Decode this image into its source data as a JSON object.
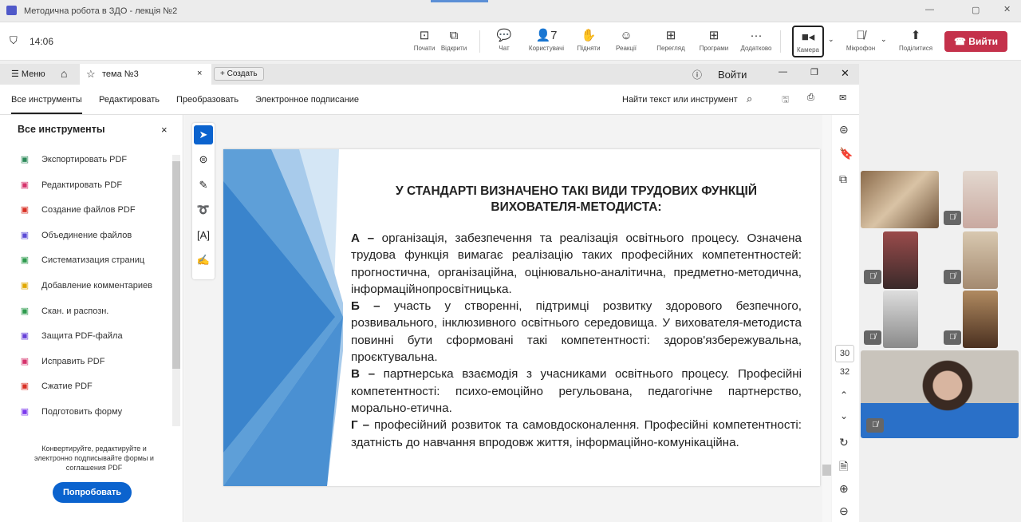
{
  "window": {
    "title": "Методична робота в ЗДО - лекція №2"
  },
  "meeting": {
    "time": "14:06",
    "participants_count": "7",
    "buttons": [
      {
        "label": "Почати",
        "icon": "present-icon"
      },
      {
        "label": "Відкрити",
        "icon": "popout-icon"
      },
      {
        "label": "Чат",
        "icon": "chat-icon"
      },
      {
        "label": "Користувачі",
        "icon": "people-icon"
      },
      {
        "label": "Підняти",
        "icon": "hand-icon"
      },
      {
        "label": "Реакції",
        "icon": "smile-icon"
      },
      {
        "label": "Перегляд",
        "icon": "layout-icon"
      },
      {
        "label": "Програми",
        "icon": "apps-icon"
      },
      {
        "label": "Додатково",
        "icon": "more-icon"
      }
    ],
    "camera": "Камера",
    "mic": "Мікрофон",
    "share": "Поділитися",
    "leave": "Вийти"
  },
  "acrobat": {
    "menu": "Меню",
    "tab": "тема №3",
    "create": "Создать",
    "signin": "Войти",
    "toolbar_tabs": [
      "Все инструменты",
      "Редактировать",
      "Преобразовать",
      "Электронное подписание"
    ],
    "search": "Найти текст или инструмент",
    "panel_title": "Все инструменты",
    "tools": [
      {
        "label": "Экспортировать PDF",
        "color": "#2d8a5a"
      },
      {
        "label": "Редактировать PDF",
        "color": "#d6336c"
      },
      {
        "label": "Создание файлов PDF",
        "color": "#d93025"
      },
      {
        "label": "Объединение файлов",
        "color": "#5b4bd6"
      },
      {
        "label": "Систематизация страниц",
        "color": "#2e9b4e"
      },
      {
        "label": "Добавление комментариев",
        "color": "#e0a800"
      },
      {
        "label": "Скан. и распозн.",
        "color": "#2e9b4e"
      },
      {
        "label": "Защита PDF-файла",
        "color": "#6741d9"
      },
      {
        "label": "Исправить PDF",
        "color": "#d6336c"
      },
      {
        "label": "Сжатие PDF",
        "color": "#d93025"
      },
      {
        "label": "Подготовить форму",
        "color": "#7c3aed"
      }
    ],
    "promo": "Конвертируйте, редактируйте и электронно подписывайте формы и соглашения PDF",
    "try": "Попробовать",
    "page_current": "30",
    "page_total": "32"
  },
  "slide": {
    "title": "У СТАНДАРТІ ВИЗНАЧЕНО ТАКІ ВИДИ ТРУДОВИХ ФУНКЦІЙ ВИХОВАТЕЛЯ-МЕТОДИСТА:",
    "paragraphs": [
      {
        "key": "А –",
        "text": " організація, забезпечення та реалізація освітнього процесу. Означена трудова функція вимагає реалізацію таких професійних компетентностей: прогностична, організаційна, оцінювально-аналітична, предметно-методична, інформаційнопросвітницька."
      },
      {
        "key": "Б –",
        "text": " участь у створенні, підтримці розвитку здорового безпечного, розвивального, інклюзивного освітнього середовища. У вихователя-методиста повинні бути сформовані такі компетентності: здоров'язбережувальна, проєктувальна."
      },
      {
        "key": "В –",
        "text": " партнерська взаємодія з учасниками освітнього процесу. Професійні компетентності: психо-емоційно регульована, педагогічне партнерство, морально-етична."
      },
      {
        "key": "Г –",
        "text": " професійний розвиток та самовдосконалення. Професійні компетентності: здатність до навчання впродовж життя, інформаційно-комунікаційна."
      }
    ]
  }
}
